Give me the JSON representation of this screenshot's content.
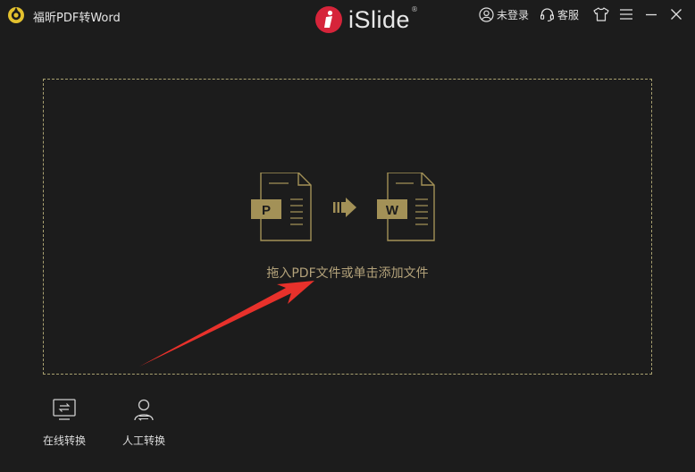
{
  "window": {
    "title": "福昕PDF转Word",
    "brand_name": "iSlide",
    "brand_reg": "®"
  },
  "header": {
    "login_label": "未登录",
    "service_label": "客服"
  },
  "dropzone": {
    "hint": "拖入PDF文件或单击添加文件",
    "source_letter": "P",
    "target_letter": "W"
  },
  "actions": [
    {
      "label": "在线转换",
      "icon": "monitor-convert-icon"
    },
    {
      "label": "人工转换",
      "icon": "person-convert-icon"
    }
  ],
  "colors": {
    "background": "#1c1c1c",
    "accent_gold": "#a39157",
    "brand_red": "#d6243a",
    "annotation_red": "#e8312b"
  }
}
